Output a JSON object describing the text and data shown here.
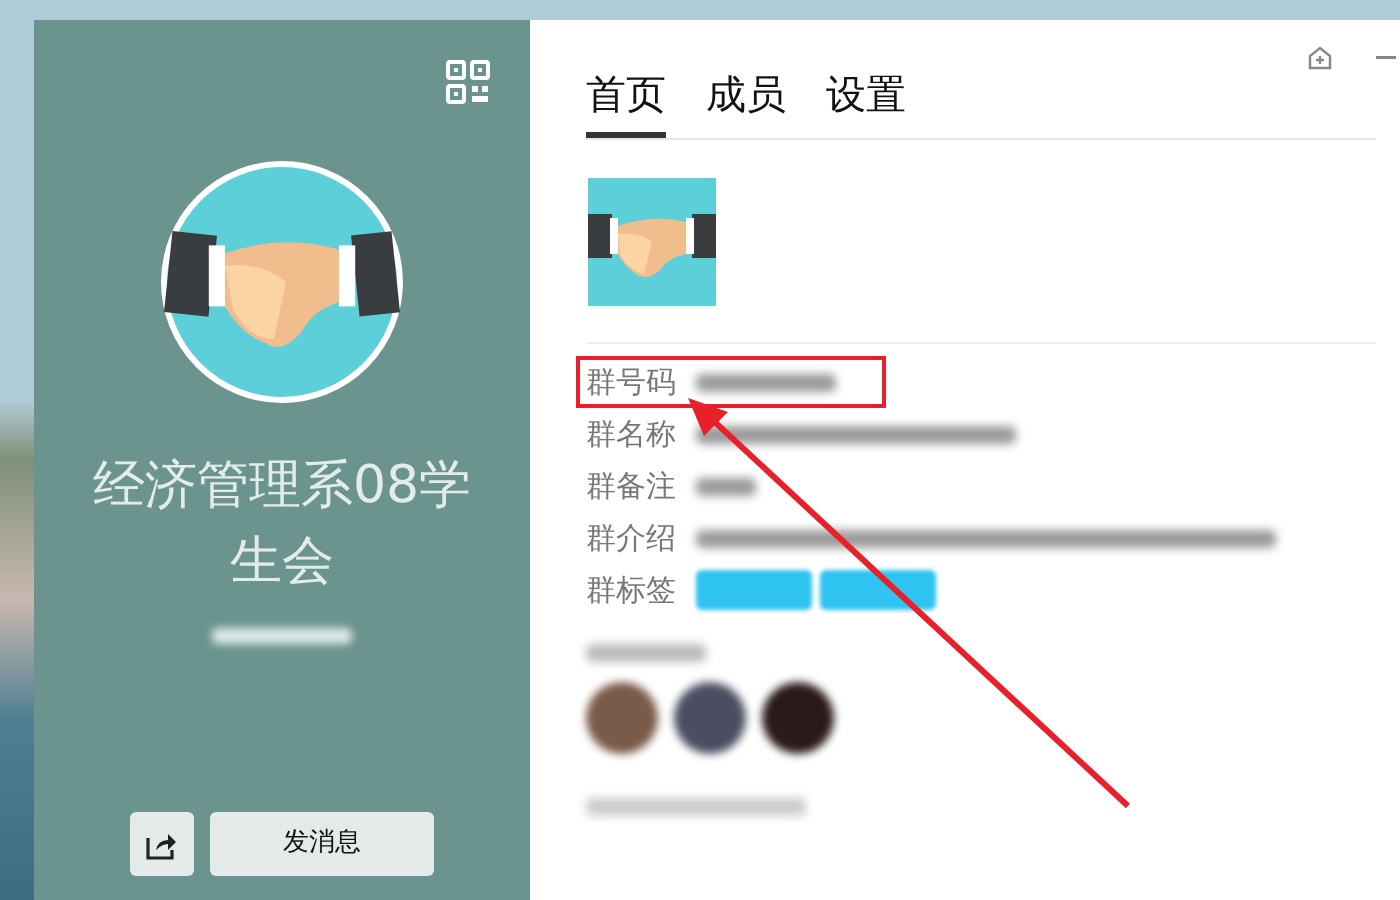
{
  "profile": {
    "group_name": "经济管理系08学生会",
    "send_button": "发消息"
  },
  "tabs": [
    {
      "label": "首页",
      "selected": true
    },
    {
      "label": "成员",
      "selected": false
    },
    {
      "label": "设置",
      "selected": false
    }
  ],
  "info_rows": [
    {
      "label": "群号码",
      "kind": "text",
      "highlighted": true
    },
    {
      "label": "群名称",
      "kind": "text",
      "highlighted": false
    },
    {
      "label": "群备注",
      "kind": "text",
      "highlighted": false
    },
    {
      "label": "群介绍",
      "kind": "text",
      "highlighted": false
    },
    {
      "label": "群标签",
      "kind": "tags",
      "highlighted": false
    }
  ]
}
